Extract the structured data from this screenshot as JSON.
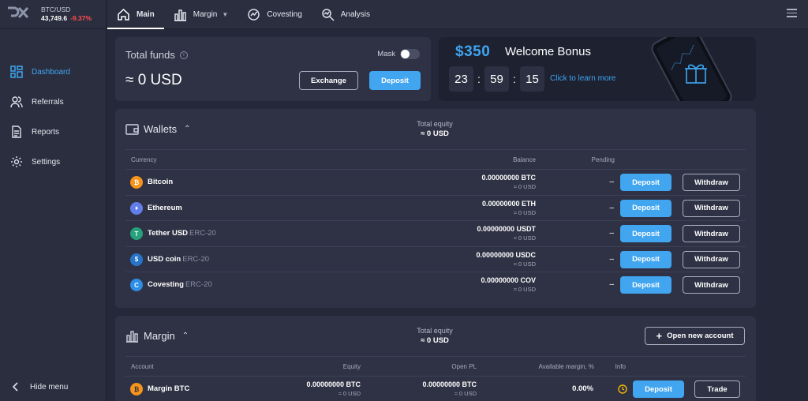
{
  "ticker": {
    "pair": "BTC/USD",
    "price": "43,749.6",
    "change": "-9.37%"
  },
  "sidebar": {
    "items": [
      {
        "label": "Dashboard",
        "icon": "dashboard-icon"
      },
      {
        "label": "Referrals",
        "icon": "users-icon"
      },
      {
        "label": "Reports",
        "icon": "document-icon"
      },
      {
        "label": "Settings",
        "icon": "gear-icon"
      }
    ],
    "hide_label": "Hide menu"
  },
  "tabs": [
    {
      "label": "Main",
      "icon": "home-icon"
    },
    {
      "label": "Margin",
      "icon": "bar-chart-icon"
    },
    {
      "label": "Covesting",
      "icon": "covesting-icon"
    },
    {
      "label": "Analysis",
      "icon": "analysis-icon"
    }
  ],
  "funds": {
    "title": "Total funds",
    "value": "≈ 0 USD",
    "mask_label": "Mask",
    "exchange_label": "Exchange",
    "deposit_label": "Deposit"
  },
  "bonus": {
    "amount": "$350",
    "title": "Welcome Bonus",
    "hours": "23",
    "minutes": "59",
    "seconds": "15",
    "link": "Click to learn more"
  },
  "wallets": {
    "title": "Wallets",
    "equity_label": "Total equity",
    "equity_value": "≈ 0 USD",
    "columns": {
      "currency": "Currency",
      "balance": "Balance",
      "pending": "Pending"
    },
    "deposit_label": "Deposit",
    "withdraw_label": "Withdraw",
    "rows": [
      {
        "name": "Bitcoin",
        "network": "",
        "balance": "0.00000000 BTC",
        "usd": "≈ 0 USD",
        "pending": "–",
        "icon": "bitcoin-icon",
        "color": "#f7931a",
        "glyph": "₿"
      },
      {
        "name": "Ethereum",
        "network": "",
        "balance": "0.00000000 ETH",
        "usd": "≈ 0 USD",
        "pending": "–",
        "icon": "ethereum-icon",
        "color": "#627eea",
        "glyph": "♦"
      },
      {
        "name": "Tether USD",
        "network": "ERC-20",
        "balance": "0.00000000 USDT",
        "usd": "≈ 0 USD",
        "pending": "–",
        "icon": "tether-icon",
        "color": "#26a17b",
        "glyph": "T"
      },
      {
        "name": "USD coin",
        "network": "ERC-20",
        "balance": "0.00000000 USDC",
        "usd": "≈ 0 USD",
        "pending": "–",
        "icon": "usdc-icon",
        "color": "#2775ca",
        "glyph": "$"
      },
      {
        "name": "Covesting",
        "network": "ERC-20",
        "balance": "0.00000000 COV",
        "usd": "≈ 0 USD",
        "pending": "–",
        "icon": "covesting-coin-icon",
        "color": "#2c8ee8",
        "glyph": "C"
      }
    ]
  },
  "margin": {
    "title": "Margin",
    "equity_label": "Total equity",
    "equity_value": "≈ 0 USD",
    "open_account_label": "Open new account",
    "columns": {
      "account": "Account",
      "equity": "Equity",
      "open_pl": "Open PL",
      "available": "Available margin, %",
      "info": "Info"
    },
    "row": {
      "name": "Margin BTC",
      "equity": "0.00000000 BTC",
      "equity_usd": "≈ 0 USD",
      "pl": "0.00000000 BTC",
      "pl_usd": "≈ 0 USD",
      "available": "0.00%",
      "deposit_label": "Deposit",
      "trade_label": "Trade"
    }
  }
}
